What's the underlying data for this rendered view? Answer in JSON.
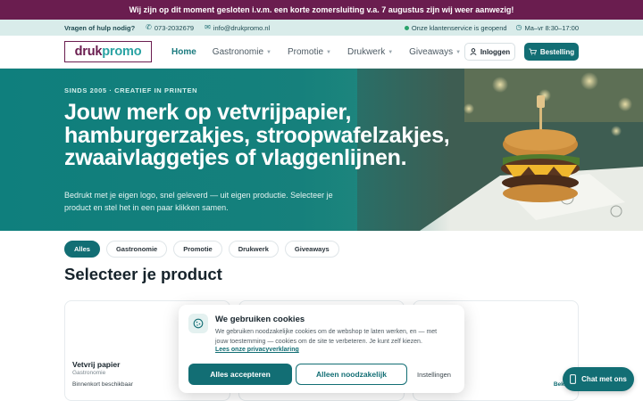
{
  "announcement": "Wij zijn op dit moment gesloten i.v.m. een korte zomersluiting v.a. 7 augustus zijn wij weer aanwezig!",
  "contact": {
    "help": "Vragen of hulp nodig?",
    "phone": "073-2032679",
    "email": "info@drukpromo.nl",
    "service_status": "Onze klantenservice is geopend",
    "hours": "Ma–vr 8:30–17:00"
  },
  "logo": {
    "part1": "druk",
    "part2": "promo"
  },
  "nav": {
    "home": "Home",
    "gastronomie": "Gastronomie",
    "promotie": "Promotie",
    "drukwerk": "Drukwerk",
    "giveaways": "Giveaways",
    "login": "Inloggen",
    "order": "Bestelling"
  },
  "hero": {
    "kicker": "SINDS 2005 · CREATIEF IN PRINTEN",
    "headline": "Jouw merk op vetvrijpapier, hamburgerzakjes, stroopwafelzakjes, zwaaivlaggetjes of vlaggenlijnen.",
    "sub": "Bedrukt met je eigen logo, snel geleverd — uit eigen productie. Selecteer je product en stel het in een paar klikken samen."
  },
  "filters": [
    "Alles",
    "Gastronomie",
    "Promotie",
    "Drukwerk",
    "Giveaways"
  ],
  "section_title": "Selecteer je product",
  "cards": [
    {
      "title": "Vetvrij papier",
      "category": "Gastronomie",
      "availability": "Binnenkort beschikbaar",
      "link": ""
    },
    {
      "title": "",
      "category": "",
      "availability": "",
      "link": ""
    },
    {
      "title": "jes",
      "category": "",
      "availability": "rkbaar",
      "link": "Bekijk"
    }
  ],
  "cookie": {
    "title": "We gebruiken cookies",
    "text": "We gebruiken noodzakelijke cookies om de webshop te laten werken, en — met jouw toestemming — cookies om de site te verbeteren. Je kunt zelf kiezen.",
    "link": "Lees onze privacyverklaring",
    "accept": "Alles accepteren",
    "necessary": "Alleen noodzakelijk",
    "settings": "Instellingen"
  },
  "chat": "Chat met ons",
  "colors": {
    "brand_purple": "#6a1d4f",
    "brand_teal": "#126e74",
    "hero_teal": "#16867f"
  }
}
